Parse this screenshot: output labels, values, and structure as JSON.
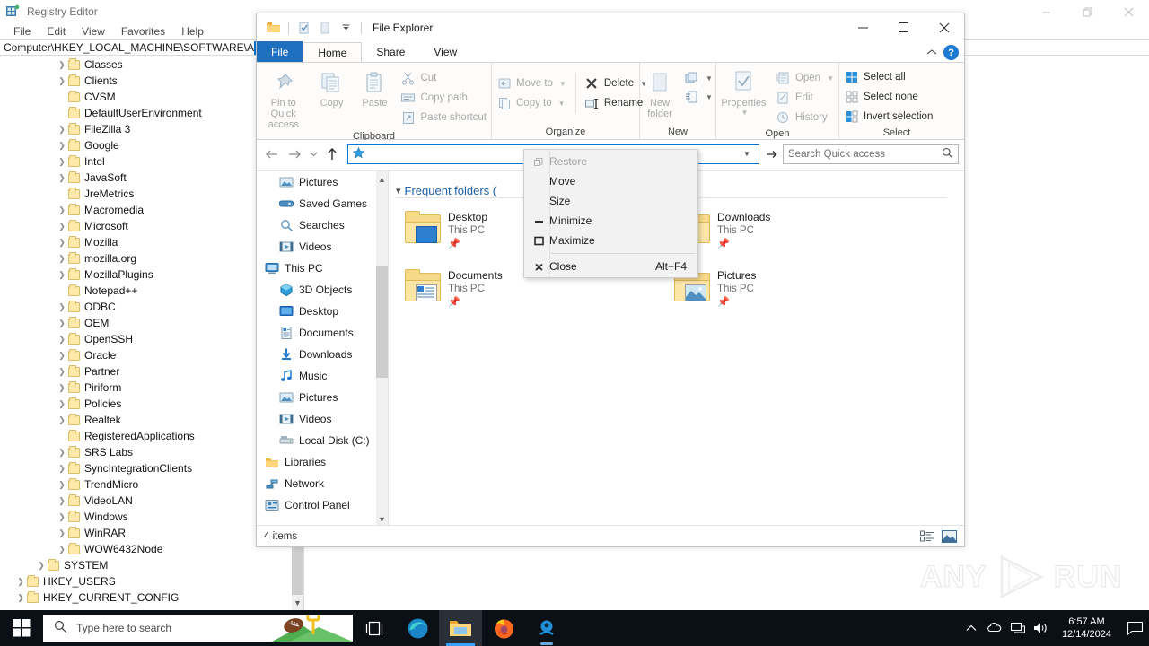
{
  "registry_editor": {
    "title": "Registry Editor",
    "icon": "registry-editor-icon",
    "menu": [
      "File",
      "Edit",
      "View",
      "Favorites",
      "Help"
    ],
    "address": "Computer\\HKEY_LOCAL_MACHINE\\SOFTWARE\\Ado",
    "window_controls": {
      "minimize": "—",
      "restore": "❐",
      "close": "✕"
    },
    "tree": [
      {
        "label": "Classes",
        "indent": 2,
        "arrow": true
      },
      {
        "label": "Clients",
        "indent": 2,
        "arrow": true
      },
      {
        "label": "CVSM",
        "indent": 2,
        "arrow": false
      },
      {
        "label": "DefaultUserEnvironment",
        "indent": 2,
        "arrow": false
      },
      {
        "label": "FileZilla 3",
        "indent": 2,
        "arrow": true
      },
      {
        "label": "Google",
        "indent": 2,
        "arrow": true
      },
      {
        "label": "Intel",
        "indent": 2,
        "arrow": true
      },
      {
        "label": "JavaSoft",
        "indent": 2,
        "arrow": true
      },
      {
        "label": "JreMetrics",
        "indent": 2,
        "arrow": false
      },
      {
        "label": "Macromedia",
        "indent": 2,
        "arrow": true
      },
      {
        "label": "Microsoft",
        "indent": 2,
        "arrow": true
      },
      {
        "label": "Mozilla",
        "indent": 2,
        "arrow": true
      },
      {
        "label": "mozilla.org",
        "indent": 2,
        "arrow": true
      },
      {
        "label": "MozillaPlugins",
        "indent": 2,
        "arrow": true
      },
      {
        "label": "Notepad++",
        "indent": 2,
        "arrow": false
      },
      {
        "label": "ODBC",
        "indent": 2,
        "arrow": true
      },
      {
        "label": "OEM",
        "indent": 2,
        "arrow": true
      },
      {
        "label": "OpenSSH",
        "indent": 2,
        "arrow": true
      },
      {
        "label": "Oracle",
        "indent": 2,
        "arrow": true
      },
      {
        "label": "Partner",
        "indent": 2,
        "arrow": true
      },
      {
        "label": "Piriform",
        "indent": 2,
        "arrow": true
      },
      {
        "label": "Policies",
        "indent": 2,
        "arrow": true
      },
      {
        "label": "Realtek",
        "indent": 2,
        "arrow": true
      },
      {
        "label": "RegisteredApplications",
        "indent": 2,
        "arrow": false
      },
      {
        "label": "SRS Labs",
        "indent": 2,
        "arrow": true
      },
      {
        "label": "SyncIntegrationClients",
        "indent": 2,
        "arrow": true
      },
      {
        "label": "TrendMicro",
        "indent": 2,
        "arrow": true
      },
      {
        "label": "VideoLAN",
        "indent": 2,
        "arrow": true
      },
      {
        "label": "Windows",
        "indent": 2,
        "arrow": true
      },
      {
        "label": "WinRAR",
        "indent": 2,
        "arrow": true
      },
      {
        "label": "WOW6432Node",
        "indent": 2,
        "arrow": true
      },
      {
        "label": "SYSTEM",
        "indent": 1,
        "arrow": true
      },
      {
        "label": "HKEY_USERS",
        "indent": 0,
        "arrow": true
      },
      {
        "label": "HKEY_CURRENT_CONFIG",
        "indent": 0,
        "arrow": true
      }
    ]
  },
  "explorer": {
    "title": "File Explorer",
    "quick_access_icons": [
      "folder-icon",
      "properties-icon",
      "new-folder-icon",
      "customize-qat-chevron-icon"
    ],
    "window_controls": {
      "minimize": "minimize-icon",
      "maximize": "maximize-icon",
      "close": "close-icon"
    },
    "tabs": [
      {
        "label": "File",
        "kind": "file"
      },
      {
        "label": "Home",
        "kind": "active"
      },
      {
        "label": "Share",
        "kind": "normal"
      },
      {
        "label": "View",
        "kind": "normal"
      }
    ],
    "ribbon_right": {
      "collapse": "collapse-ribbon-icon",
      "help": "?"
    },
    "ribbon": {
      "clipboard": {
        "label": "Clipboard",
        "big": [
          {
            "label": "Pin to Quick\naccess",
            "icon": "pin-icon",
            "disabled": true
          },
          {
            "label": "Copy",
            "icon": "copy-icon",
            "disabled": true
          },
          {
            "label": "Paste",
            "icon": "paste-icon",
            "disabled": true
          }
        ],
        "small": [
          {
            "label": "Cut",
            "icon": "cut-icon",
            "disabled": true
          },
          {
            "label": "Copy path",
            "icon": "copy-path-icon",
            "disabled": true
          },
          {
            "label": "Paste shortcut",
            "icon": "paste-shortcut-icon",
            "disabled": true
          }
        ]
      },
      "organize": {
        "label": "Organize",
        "col1": [
          {
            "label": "Move to",
            "icon": "move-to-icon",
            "disabled": true,
            "caret": true
          },
          {
            "label": "Copy to",
            "icon": "copy-to-icon",
            "disabled": true,
            "caret": true
          }
        ],
        "col2": [
          {
            "label": "Delete",
            "icon": "delete-icon",
            "disabled": false,
            "caret": true
          },
          {
            "label": "Rename",
            "icon": "rename-icon",
            "disabled": false,
            "caret": false
          }
        ]
      },
      "new": {
        "label": "New",
        "big": {
          "label": "New\nfolder",
          "icon": "new-folder-icon",
          "disabled": true
        },
        "small": [
          {
            "label": "",
            "icon": "new-item-icon",
            "caret": true
          },
          {
            "label": "",
            "icon": "easy-access-icon",
            "caret": true
          }
        ]
      },
      "open": {
        "label": "Open",
        "big": {
          "label": "Properties",
          "icon": "properties-icon",
          "disabled": true,
          "caret": true
        },
        "small": [
          {
            "label": "Open",
            "icon": "open-icon",
            "disabled": true,
            "caret": true
          },
          {
            "label": "Edit",
            "icon": "edit-icon",
            "disabled": true,
            "caret": false
          },
          {
            "label": "History",
            "icon": "history-icon",
            "disabled": true,
            "caret": false
          }
        ]
      },
      "select": {
        "label": "Select",
        "items": [
          {
            "label": "Select all",
            "icon": "select-all-icon"
          },
          {
            "label": "Select none",
            "icon": "select-none-icon"
          },
          {
            "label": "Invert selection",
            "icon": "invert-selection-icon"
          }
        ]
      }
    },
    "address_bar": {
      "back": "back-arrow-icon",
      "forward": "forward-arrow-icon",
      "recent": "recent-locations-chevron-icon",
      "up": "up-arrow-icon",
      "value": "",
      "icon": "quick-access-star-icon",
      "dropdown": "address-dropdown-chevron-icon",
      "refresh": "refresh-icon"
    },
    "search": {
      "placeholder": "Search Quick access",
      "icon": "search-icon"
    },
    "nav_pane": [
      {
        "label": "Pictures",
        "icon": "pictures-icon",
        "indent": 1
      },
      {
        "label": "Saved Games",
        "icon": "saved-games-icon",
        "indent": 1
      },
      {
        "label": "Searches",
        "icon": "searches-icon",
        "indent": 1
      },
      {
        "label": "Videos",
        "icon": "videos-icon",
        "indent": 1
      },
      {
        "label": "This PC",
        "icon": "this-pc-icon",
        "indent": 0
      },
      {
        "label": "3D Objects",
        "icon": "3d-objects-icon",
        "indent": 1
      },
      {
        "label": "Desktop",
        "icon": "desktop-icon",
        "indent": 1
      },
      {
        "label": "Documents",
        "icon": "documents-icon",
        "indent": 1
      },
      {
        "label": "Downloads",
        "icon": "downloads-icon",
        "indent": 1
      },
      {
        "label": "Music",
        "icon": "music-icon",
        "indent": 1
      },
      {
        "label": "Pictures",
        "icon": "pictures-icon",
        "indent": 1
      },
      {
        "label": "Videos",
        "icon": "videos-icon",
        "indent": 1
      },
      {
        "label": "Local Disk (C:)",
        "icon": "local-disk-icon",
        "indent": 1
      },
      {
        "label": "Libraries",
        "icon": "libraries-icon",
        "indent": 0
      },
      {
        "label": "Network",
        "icon": "network-icon",
        "indent": 0
      },
      {
        "label": "Control Panel",
        "icon": "control-panel-icon",
        "indent": 0
      }
    ],
    "content": {
      "group_header": "Frequent folders (",
      "tiles": [
        {
          "name": "Desktop",
          "sub": "This PC",
          "pinned": true,
          "icon": "desktop-folder-icon"
        },
        {
          "name": "Downloads",
          "sub": "This PC",
          "pinned": true,
          "icon": "downloads-folder-icon"
        },
        {
          "name": "Documents",
          "sub": "This PC",
          "pinned": true,
          "icon": "documents-folder-icon"
        },
        {
          "name": "Pictures",
          "sub": "This PC",
          "pinned": true,
          "icon": "pictures-folder-icon"
        }
      ]
    },
    "status": {
      "items": "4 items",
      "view_details": "details-view-icon",
      "view_large": "large-icons-view-icon"
    }
  },
  "system_menu": {
    "items": [
      {
        "label": "Restore",
        "icon": "restore-icon",
        "accel": "",
        "disabled": true
      },
      {
        "label": "Move",
        "icon": "",
        "accel": "",
        "disabled": false
      },
      {
        "label": "Size",
        "icon": "",
        "accel": "",
        "disabled": false
      },
      {
        "label": "Minimize",
        "icon": "minimize-icon",
        "accel": "",
        "disabled": false
      },
      {
        "label": "Maximize",
        "icon": "maximize-icon",
        "accel": "",
        "disabled": false
      },
      {
        "label": "Close",
        "icon": "close-x-icon",
        "accel": "Alt+F4",
        "disabled": false
      }
    ]
  },
  "taskbar": {
    "start": "windows-start-icon",
    "search_placeholder": "Type here to search",
    "search_icon": "search-icon",
    "task_view": "task-view-icon",
    "apps": [
      {
        "name": "microsoft-edge",
        "state": "idle"
      },
      {
        "name": "file-explorer",
        "state": "active"
      },
      {
        "name": "mozilla-firefox",
        "state": "idle"
      },
      {
        "name": "unknown-blue-app",
        "state": "open"
      }
    ],
    "tray": [
      "show-hidden-icons-chevron",
      "onedrive-icon",
      "network-icon",
      "volume-icon"
    ],
    "time": "6:57 AM",
    "date": "12/14/2024",
    "action_center": "action-center-icon"
  },
  "watermark": {
    "left": "ANY",
    "right": "RUN"
  },
  "colors": {
    "accent": "#0078d7",
    "file_tab": "#1e6fbd",
    "taskbar": "#0b0f16",
    "folder_yellow": "#f7d98a",
    "link_blue": "#1d5fa8"
  }
}
